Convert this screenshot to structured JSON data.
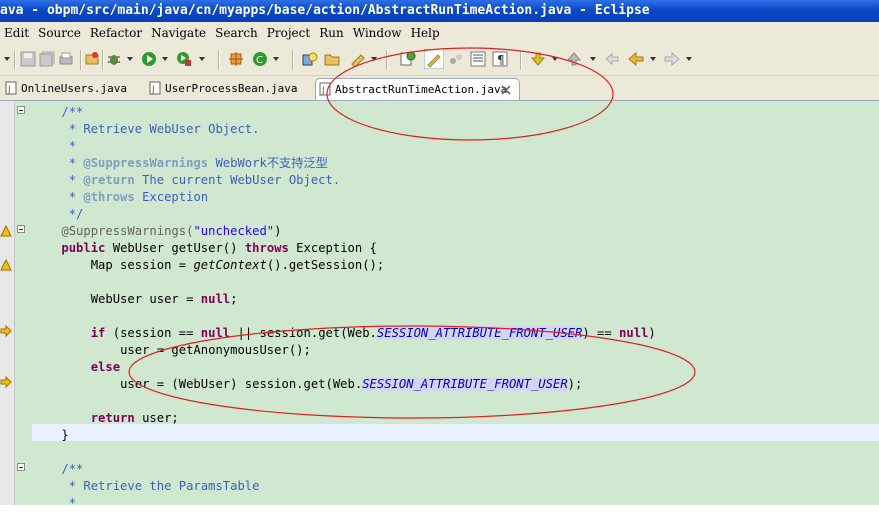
{
  "window": {
    "title": "ava - obpm/src/main/java/cn/myapps/base/action/AbstractRunTimeAction.java - Eclipse"
  },
  "menu": [
    "Edit",
    "Source",
    "Refactor",
    "Navigate",
    "Search",
    "Project",
    "Run",
    "Window",
    "Help"
  ],
  "toolbar_icons": [
    "save-icon",
    "save-all-icon",
    "print-icon",
    "debug-icon",
    "run-icon",
    "external-tools-icon",
    "new-java-project-icon",
    "new-class-icon",
    "open-type-icon",
    "search-icon",
    "open-task-icon",
    "toggle-mark-occurrences-icon",
    "toggle-highlight-icon",
    "next-annotation-icon",
    "show-whitespace-icon",
    "prev-annotation-icon",
    "last-edit-location-icon",
    "back-icon",
    "forward-icon"
  ],
  "tabs": [
    {
      "label": "OnlineUsers.java",
      "active": false
    },
    {
      "label": "UserProcessBean.java",
      "active": false
    },
    {
      "label": "AbstractRunTimeAction.java",
      "active": true
    }
  ],
  "code": {
    "l1": "/**",
    "l2": " * Retrieve WebUser Object.",
    "l3": " *",
    "l4a": " * ",
    "l4b": "@SuppressWarnings",
    "l4c": " WebWork不支持泛型",
    "l5a": " * ",
    "l5b": "@return",
    "l5c": " The current WebUser Object.",
    "l6a": " * ",
    "l6b": "@throws",
    "l6c": " Exception",
    "l7": " */",
    "l8a": "@SuppressWarnings(",
    "l8b": "\"unchecked\"",
    "l8c": ")",
    "l9a": "public",
    "l9b": " WebUser getUser() ",
    "l9c": "throws",
    "l9d": " Exception {",
    "l10a": "Map session = ",
    "l10b": "getContext",
    "l10c": "().getSession();",
    "l11a": "WebUser user = ",
    "l11b": "null",
    "l11c": ";",
    "l12a": "if",
    "l12b": " (session == ",
    "l12c": "null",
    "l12d": " || session.get(Web.",
    "l12e": "SESSION_ATTRIBUTE_FRONT_USER",
    "l12f": ") == ",
    "l12g": "null",
    "l12h": ")",
    "l13": "user = getAnonymousUser();",
    "l14": "else",
    "l15a": "user = (WebUser) session.get(Web.",
    "l15b": "SESSION_ATTRIBUTE_FRONT_USER",
    "l15c": ");",
    "l16a": "return",
    "l16b": " user;",
    "l17": "}",
    "l18": "/**",
    "l19": " * Retrieve the ParamsTable",
    "l20": " *"
  },
  "colors": {
    "keyword": "#7f0055",
    "comment": "#3f5fbf",
    "string": "#2a00ff",
    "editor_bg": "#cfe8cf",
    "annotation_oval": "#e02020"
  }
}
